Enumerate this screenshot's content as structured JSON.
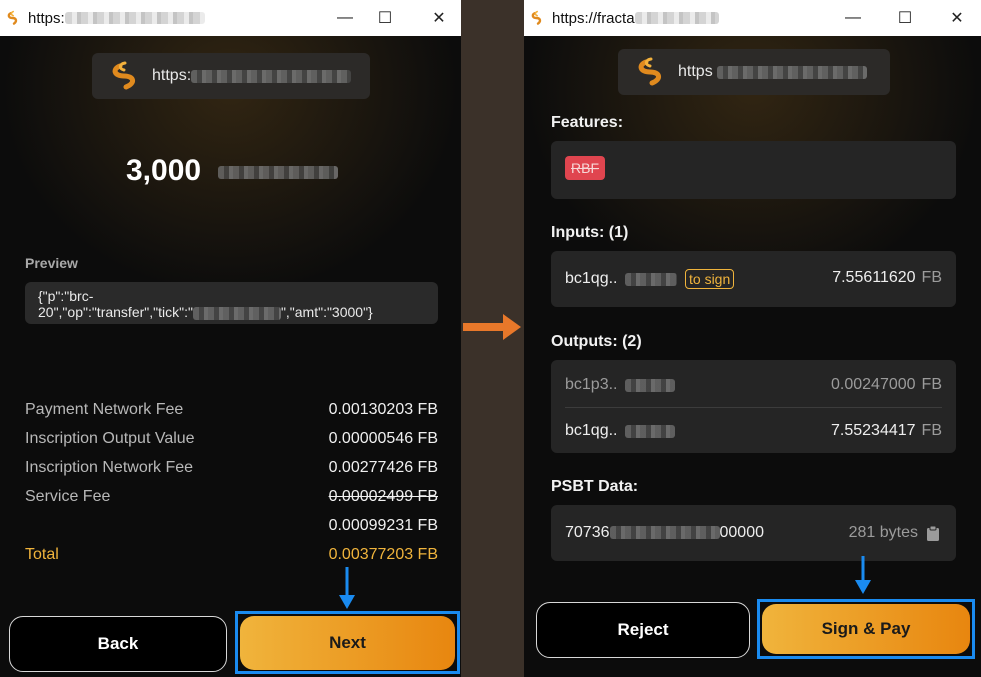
{
  "left_window": {
    "title": "https:",
    "origin": "https:",
    "amount": "3,000",
    "preview_label": "Preview",
    "preview_line1": "{\"p\":\"brc-",
    "preview_line2a": "20\",\"op\":\"transfer\",\"tick\":\"",
    "preview_line2b": "\",\"amt\":\"3000\"}",
    "fees": [
      {
        "label": "Payment Network Fee",
        "value": "0.00130203 FB"
      },
      {
        "label": "Inscription Output Value",
        "value": "0.00000546 FB"
      },
      {
        "label": "Inscription Network Fee",
        "value": "0.00277426 FB"
      },
      {
        "label": "Service Fee",
        "value": "0.00002499 FB"
      }
    ],
    "service_fee_discounted": "0.00099231 FB",
    "total_label": "Total",
    "total_value": "0.00377203 FB",
    "back_label": "Back",
    "next_label": "Next"
  },
  "right_window": {
    "title": "https://fracta",
    "origin": "https",
    "features_label": "Features:",
    "rbf_badge": "RBF",
    "inputs_label": "Inputs: (1)",
    "input": {
      "address": "bc1qg..",
      "tag": "to sign",
      "amount": "7.55611620",
      "unit": "FB"
    },
    "outputs_label": "Outputs: (2)",
    "outputs": [
      {
        "address": "bc1p3..",
        "amount": "0.00247000",
        "unit": "FB"
      },
      {
        "address": "bc1qg..",
        "amount": "7.55234417",
        "unit": "FB"
      }
    ],
    "psbt_label": "PSBT Data:",
    "psbt_prefix": "70736",
    "psbt_suffix": "00000",
    "psbt_size": "281 bytes",
    "reject_label": "Reject",
    "sign_label": "Sign & Pay"
  },
  "window_controls": {
    "minimize": "—",
    "maximize": "☐",
    "close": "✕"
  },
  "colors": {
    "accent_orange": "#e8860f",
    "accent_gold": "#f0b43c",
    "focus_blue": "#1a8bf0",
    "rbf_red": "#e0454f"
  }
}
